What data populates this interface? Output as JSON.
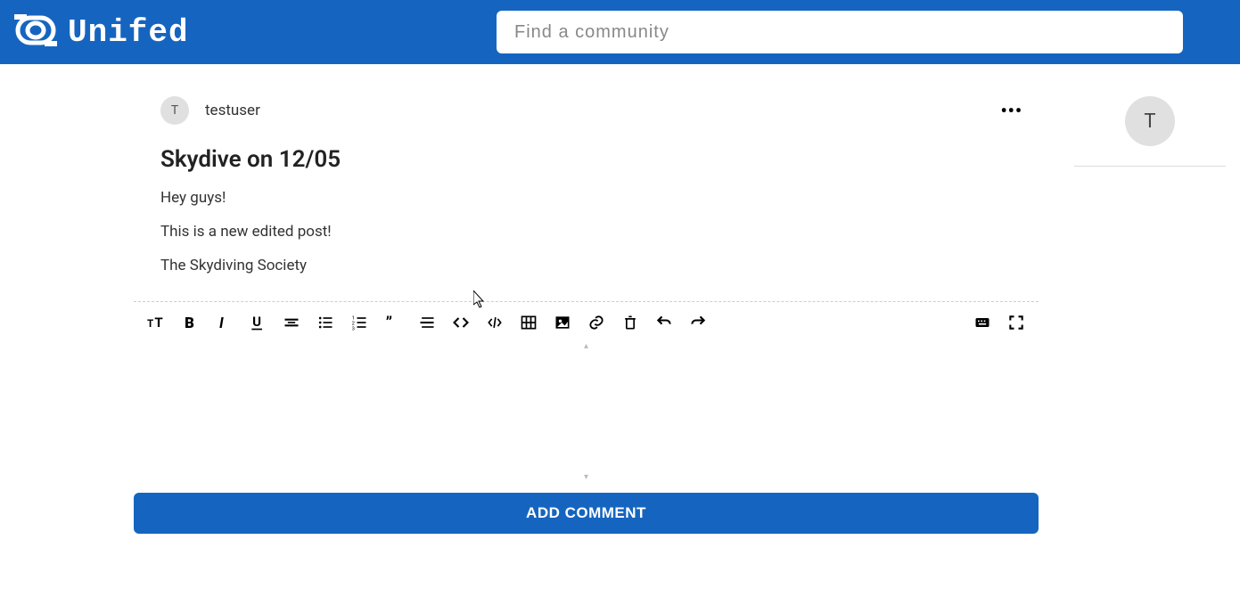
{
  "header": {
    "brand": "Unifed",
    "search_placeholder": "Find a community"
  },
  "post": {
    "author": "testuser",
    "author_initial": "T",
    "title": "Skydive on 12/05",
    "paragraphs": [
      "Hey guys!",
      "This is a new edited post!",
      "The Skydiving Society"
    ]
  },
  "toolbar_icons": [
    "text-size-icon",
    "bold-icon",
    "italic-icon",
    "underline-icon",
    "strikethrough-icon",
    "bullet-list-icon",
    "ordered-list-icon",
    "quote-icon",
    "horizontal-rule-icon",
    "code-inline-icon",
    "code-block-icon",
    "table-icon",
    "image-icon",
    "link-icon",
    "delete-icon",
    "undo-icon",
    "redo-icon"
  ],
  "toolbar_icons_right": [
    "keyboard-icon",
    "fullscreen-icon"
  ],
  "comment": {
    "submit_label": "ADD COMMENT"
  },
  "sidebar": {
    "current_user_initial": "T"
  }
}
